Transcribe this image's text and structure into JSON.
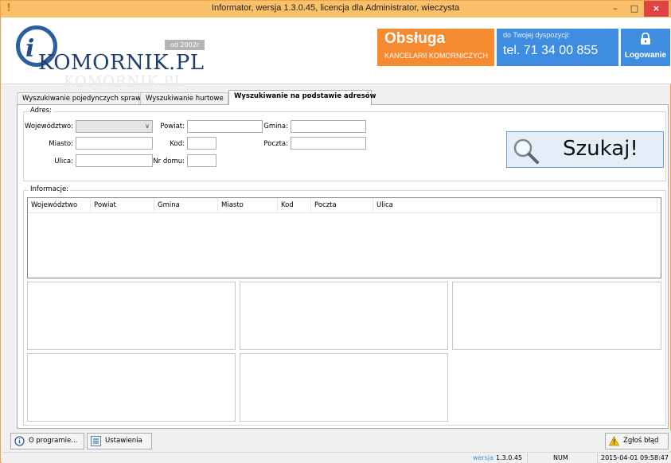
{
  "window": {
    "title": "Informator, wersja 1.3.0.45, licencja dla Administrator, wieczysta",
    "app_icon": "exclamation-icon",
    "minimize_glyph": "–",
    "maximize_glyph": "□",
    "close_glyph": "×"
  },
  "header": {
    "logo_text": "KOMORNIK.PL",
    "logo_reflection": "KOMORNIK.PL",
    "since": "od 2002r",
    "service_title": "Obsługa",
    "service_subtitle": "KANCELARII KOMORNICZYCH",
    "contact_small": "do Twojej dyspozycji:",
    "contact_phone": "tel. 71 34 00 855",
    "login_label": "Logowanie",
    "colors": {
      "service": "#f58a30",
      "contact": "#3f8de0"
    }
  },
  "tabs": [
    {
      "label": "Wyszukiwanie pojedynczych spraw"
    },
    {
      "label": "Wyszukiwanie hurtowe"
    },
    {
      "label": "Wyszukiwanie na podstawie adresów"
    }
  ],
  "address": {
    "legend": "Adres:",
    "wojewodztwo_label": "Województwo:",
    "wojewodztwo_value": "",
    "powiat_label": "Powiat:",
    "powiat_value": "",
    "gmina_label": "Gmina:",
    "gmina_value": "",
    "miasto_label": "Miasto:",
    "miasto_value": "",
    "kod_label": "Kod:",
    "kod_value": "",
    "poczta_label": "Poczta:",
    "poczta_value": "",
    "ulica_label": "Ulica:",
    "ulica_value": "",
    "nr_domu_label": "Nr domu:",
    "nr_domu_value": "",
    "search_button": "Szukaj!"
  },
  "info": {
    "legend": "Informacje:",
    "columns": [
      "Województwo",
      "Powiat",
      "Gmina",
      "Miasto",
      "Kod",
      "Poczta",
      "Ulica"
    ]
  },
  "bottom": {
    "about_button": "O programie...",
    "settings_button": "Ustawienia",
    "report_button": "Zgłoś błąd"
  },
  "status": {
    "version_label": "wersja",
    "version": "1.3.0.45",
    "num": "NUM",
    "datetime": "2015-04-01 09:58:47"
  }
}
